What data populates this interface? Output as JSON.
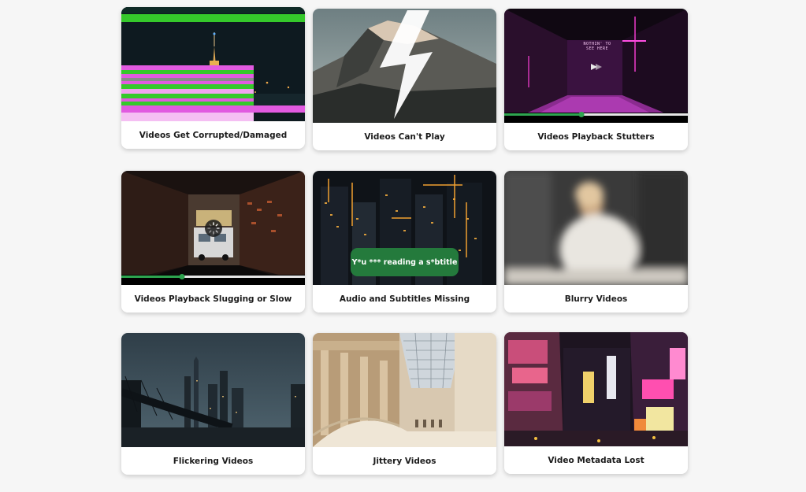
{
  "cards": [
    {
      "title": "Videos Get Corrupted/Damaged"
    },
    {
      "title": "Videos Can't Play"
    },
    {
      "title": "Videos Playback Stutters",
      "neon_sign": "NOTHIN' TO SEE HERE",
      "progress": 0.42
    },
    {
      "title": "Videos Playback Slugging or Slow",
      "progress": 0.33
    },
    {
      "title": "Audio and Subtitles Missing",
      "subtitle_text": "Y*u *** reading a s*btitle"
    },
    {
      "title": "Blurry Videos"
    },
    {
      "title": "Flickering Videos"
    },
    {
      "title": "Jittery Videos"
    },
    {
      "title": "Video Metadata Lost"
    }
  ],
  "colors": {
    "accent_green": "#2ea44f",
    "subtitle_bg": "#247a3c",
    "glitch_green": "#35c92b",
    "glitch_pink": "#e15ae0"
  }
}
